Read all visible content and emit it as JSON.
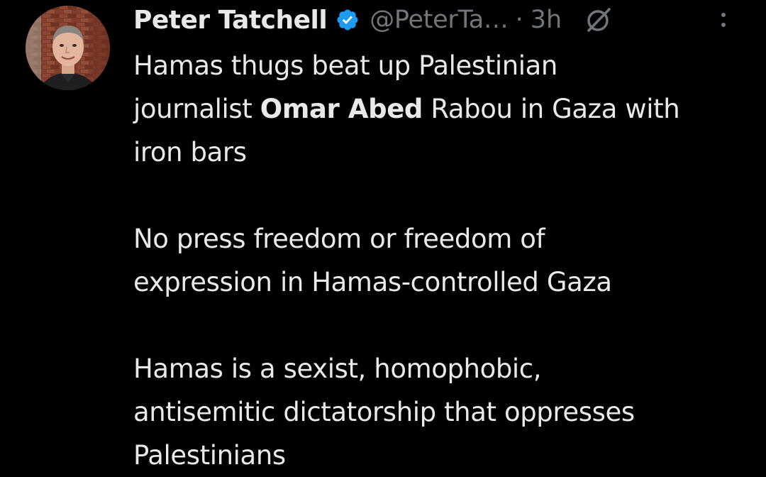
{
  "tweet": {
    "author": {
      "display_name": "Peter Tatchell",
      "handle": "@PeterTa…",
      "verified": true,
      "verified_icon": "verified-badge-icon",
      "avatar_icon": "avatar"
    },
    "separator": "·",
    "time": "3h",
    "grok_icon": "grok-icon",
    "more_icon": "more-options-icon",
    "paragraph1": {
      "text1": "Hamas thugs beat up Palestinian",
      "text2": "journalist ",
      "bold": "Omar Abed",
      "text3": " Rabou in Gaza with",
      "text4": "iron bars"
    },
    "paragraph2": {
      "line1": "No press freedom or freedom of",
      "line2": "expression in Hamas-controlled Gaza"
    },
    "paragraph3": {
      "line1": "Hamas is a sexist, homophobic,",
      "line2": "antisemitic dictatorship that oppresses",
      "line3": "Palestinians"
    }
  },
  "colors": {
    "background": "#000000",
    "primary_text": "#e7e9ea",
    "secondary_text": "#71767b",
    "verified_blue": "#1d9bf0"
  }
}
